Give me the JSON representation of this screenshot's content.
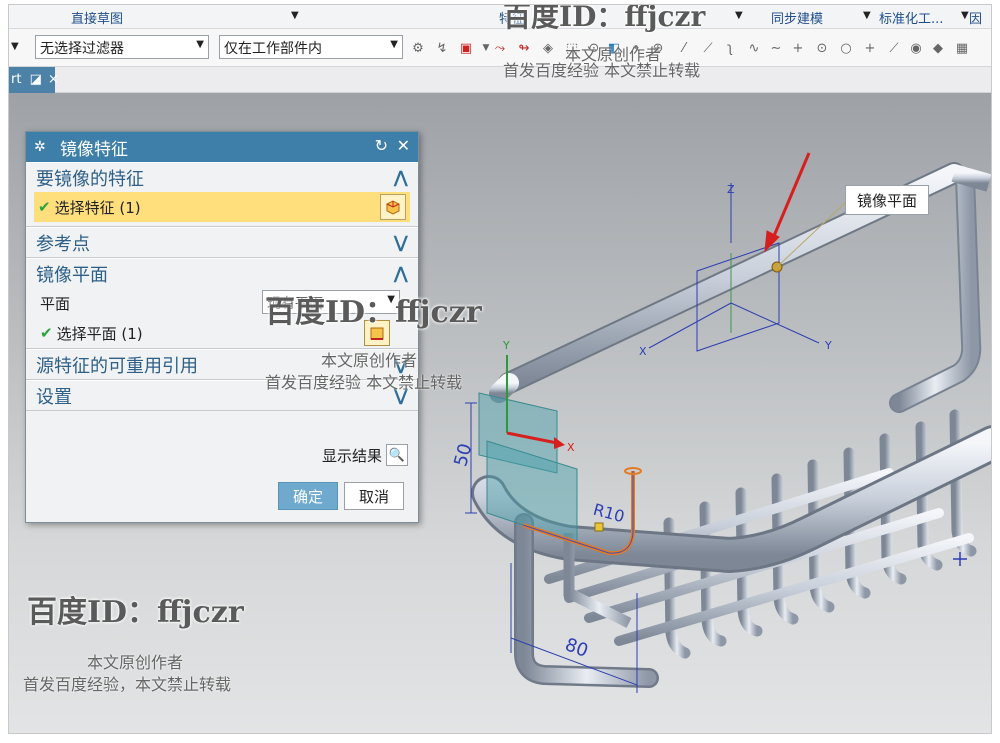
{
  "ribbon": {
    "group_direct_sketch": "直接草图",
    "group_feature": "特征",
    "group_sync_modeling": "同步建模",
    "group_standard": "标准化工...",
    "group_cut": "因"
  },
  "selection_bar": {
    "filter_value": "无选择过滤器",
    "scope_value": "仅在工作部件内"
  },
  "tab": {
    "label": "rt",
    "close": "×"
  },
  "dialog": {
    "title": "镜像特征",
    "sections": {
      "features_to_mirror": "要镜像的特征",
      "select_feature": "选择特征 (1)",
      "reference_point": "参考点",
      "mirror_plane": "镜像平面",
      "plane_label": "平面",
      "plane_option": "现有平面",
      "select_plane": "选择平面 (1)",
      "reusable_refs": "源特征的可重用引用",
      "settings": "设置"
    },
    "show_result": "显示结果",
    "ok": "确定",
    "cancel": "取消"
  },
  "viewport": {
    "callout": "镜像平面",
    "dim_height": "50",
    "dim_width": "80",
    "dim_radius": "R10",
    "axis_z": "Z",
    "axis_x": "X",
    "axis_y": "Y"
  },
  "watermark": {
    "big": "百度ID：ffjczr",
    "line1": "本文原创作者",
    "line2": "首发百度经验，本文禁止转载",
    "line2_short": "首发百度经验    本文禁止转载"
  },
  "colors": {
    "dialog_title": "#3e7fa9",
    "highlight_row": "#ffdf7c",
    "ok_button": "#6fa9cd",
    "arrow_red": "#d62020"
  }
}
